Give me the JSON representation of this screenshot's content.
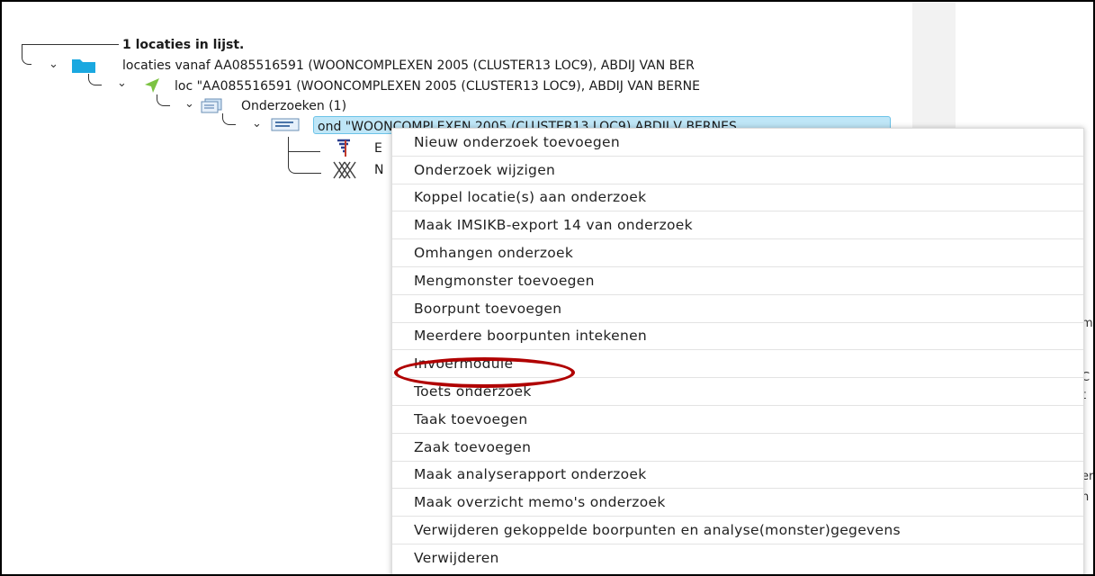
{
  "tree": {
    "count_label": "1 locaties in lijst.",
    "root_label": "locaties vanaf AA085516591 (WOONCOMPLEXEN 2005 (CLUSTER13 LOC9), ABDIJ VAN BER",
    "loc_label": "loc \"AA085516591 (WOONCOMPLEXEN 2005 (CLUSTER13 LOC9), ABDIJ VAN BERNE",
    "onderzoeken_label": "Onderzoeken (1)",
    "selected_label": "ond \"WOONCOMPLEXEN 2005 (CLUSTER13 LOC9) ABDIJ V BERNES",
    "child1_letter": "E",
    "child2_letter": "N"
  },
  "context_menu": {
    "items": [
      "Nieuw onderzoek toevoegen",
      "Onderzoek wijzigen",
      "Koppel locatie(s) aan onderzoek",
      "Maak IMSIKB-export 14 van onderzoek",
      "Omhangen onderzoek",
      "Mengmonster toevoegen",
      "Boorpunt toevoegen",
      "Meerdere boorpunten intekenen",
      "Invoermodule",
      "Toets onderzoek",
      "Taak toevoegen",
      "Zaak toevoegen",
      "Maak analyserapport onderzoek",
      "Maak overzicht memo's onderzoek",
      "Verwijderen gekoppelde boorpunten en analyse(monster)gegevens",
      "Verwijderen"
    ],
    "highlighted_item": "Invoermodule"
  },
  "right_fragments": [
    "m",
    "C",
    "t",
    "er",
    "n",
    "s"
  ],
  "colors": {
    "selection_bg": "#bfe6f7",
    "highlight_ring": "#b00000",
    "folder_icon": "#1aa8e0",
    "loc_arrow_icon": "#7cc242"
  }
}
